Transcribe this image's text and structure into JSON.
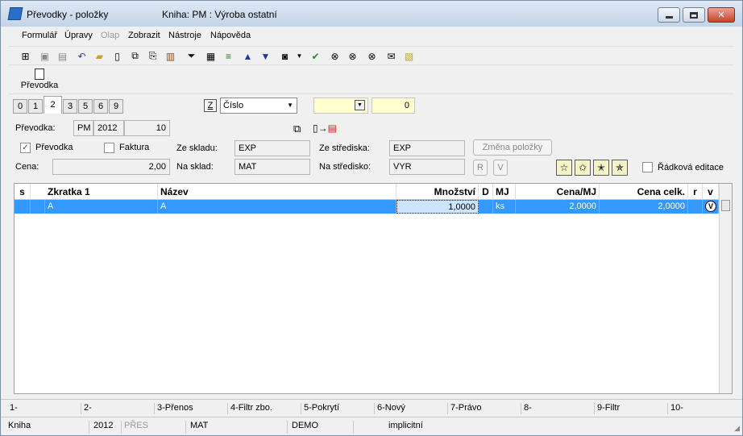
{
  "window": {
    "title": "Převodky - položky",
    "book": "Kniha: PM : Výroba ostatní"
  },
  "menu": [
    "Formulář",
    "Úpravy",
    "Olap",
    "Zobrazit",
    "Nástroje",
    "Nápověda"
  ],
  "big_tool": {
    "label": "Převodka"
  },
  "tabs": [
    "0",
    "1",
    "2",
    "3",
    "5",
    "6",
    "9"
  ],
  "active_tab": "2",
  "sort": {
    "key": "Z",
    "field": "Číslo",
    "count": "0"
  },
  "doc": {
    "label": "Převodka:",
    "series": "PM",
    "year": "2012",
    "number": "10"
  },
  "options": {
    "prevodka_label": "Převodka",
    "prevodka_checked": "✓",
    "faktura_label": "Faktura",
    "radkova_label": "Řádková editace"
  },
  "price": {
    "label": "Cena:",
    "value": "2,00"
  },
  "stock": {
    "from_label": "Ze skladu:",
    "from_value": "EXP",
    "to_label": "Na sklad:",
    "to_value": "MAT"
  },
  "center": {
    "from_label": "Ze střediska:",
    "from_value": "EXP",
    "to_label": "Na středisko:",
    "to_value": "VYR"
  },
  "buttons": {
    "change_items": "Změna položky",
    "r": "R",
    "v": "V"
  },
  "grid": {
    "columns": [
      "s",
      "Zkratka 1",
      "Název",
      "Množství",
      "D",
      "MJ",
      "Cena/MJ",
      "Cena celk.",
      "r",
      "v"
    ],
    "rows": [
      {
        "s": "",
        "zkratka": "A",
        "nazev": "A",
        "mnozstvi": "1,0000",
        "d": "",
        "mj": "ks",
        "cena_mj": "2,0000",
        "cena_celk": "2,0000",
        "r": "",
        "v": "V"
      }
    ]
  },
  "function_keys": [
    "1-",
    "2-",
    "3-Přenos",
    "4-Filtr zbo.",
    "5-Pokrytí",
    "6-Nový",
    "7-Právo",
    "8-",
    "9-Filtr",
    "10-"
  ],
  "status": [
    "Kniha",
    "2012",
    "PŘES",
    "MAT",
    "DEMO",
    "implicitní"
  ],
  "colors": {
    "selection": "#3399ff",
    "title_gradient_top": "#dfe9f5"
  }
}
